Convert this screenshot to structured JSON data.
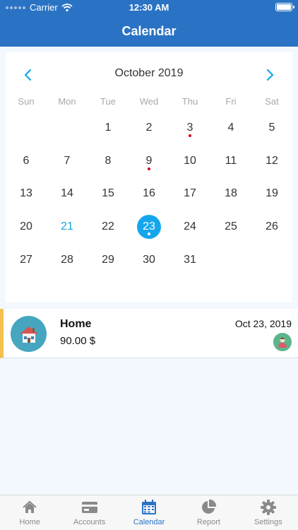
{
  "status_bar": {
    "carrier": "Carrier",
    "time": "12:30 AM"
  },
  "nav": {
    "title": "Calendar"
  },
  "calendar": {
    "month_label": "October 2019",
    "weekdays": [
      "Sun",
      "Mon",
      "Tue",
      "Wed",
      "Thu",
      "Fri",
      "Sat"
    ],
    "leading_blanks": 2,
    "days": [
      "1",
      "2",
      "3",
      "4",
      "5",
      "6",
      "7",
      "8",
      "9",
      "10",
      "11",
      "12",
      "13",
      "14",
      "15",
      "16",
      "17",
      "18",
      "19",
      "20",
      "21",
      "22",
      "23",
      "24",
      "25",
      "26",
      "27",
      "28",
      "29",
      "30",
      "31"
    ],
    "today": "21",
    "selected": "23",
    "marked_days": [
      "3",
      "9",
      "23"
    ],
    "colors": {
      "accent": "#14a6ec",
      "today": "#14a6d9",
      "marker": "#d0021b"
    }
  },
  "entry": {
    "title": "Home",
    "amount": "90.00 $",
    "date": "Oct 23, 2019",
    "icon": "house-icon",
    "category_color": "#f5c14e"
  },
  "tabs": [
    {
      "label": "Home",
      "icon": "home-icon"
    },
    {
      "label": "Accounts",
      "icon": "credit-card-icon"
    },
    {
      "label": "Calendar",
      "icon": "calendar-icon",
      "active": true
    },
    {
      "label": "Report",
      "icon": "pie-chart-icon"
    },
    {
      "label": "Settings",
      "icon": "gear-icon"
    }
  ],
  "theme": {
    "primary": "#2a73c4",
    "background": "#f2f8fd"
  }
}
